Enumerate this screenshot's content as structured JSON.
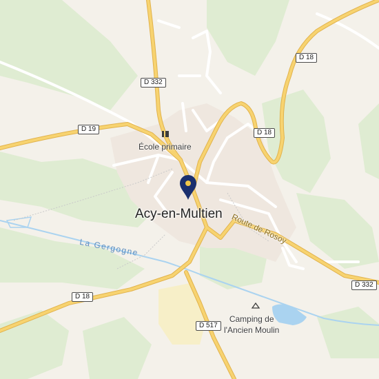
{
  "map": {
    "place_label": "Acy-en-Multien",
    "river_label": "La Gergogne",
    "street_label": "Route de Rosoy",
    "poi": {
      "school_label": "École primaire",
      "camping_label_line1": "Camping de",
      "camping_label_line2": "l'Ancien Moulin"
    },
    "road_shields": [
      {
        "label": "D 332",
        "id": "d332-north"
      },
      {
        "label": "D 18",
        "id": "d18-northeast"
      },
      {
        "label": "D 19",
        "id": "d19-west"
      },
      {
        "label": "D 18",
        "id": "d18-east"
      },
      {
        "label": "D 332",
        "id": "d332-east"
      },
      {
        "label": "D 18",
        "id": "d18-southwest"
      },
      {
        "label": "D 517",
        "id": "d517-south"
      }
    ],
    "icons": {
      "pin": "location-pin-icon",
      "school": "school-icon",
      "camping": "camping-icon"
    },
    "colors": {
      "background": "#f4f1ea",
      "green": "#dfecd2",
      "road_primary": "#f7d370",
      "road_casing": "#e1b24c",
      "water": "#aad3f0",
      "pin": "#1a2f6e"
    }
  }
}
